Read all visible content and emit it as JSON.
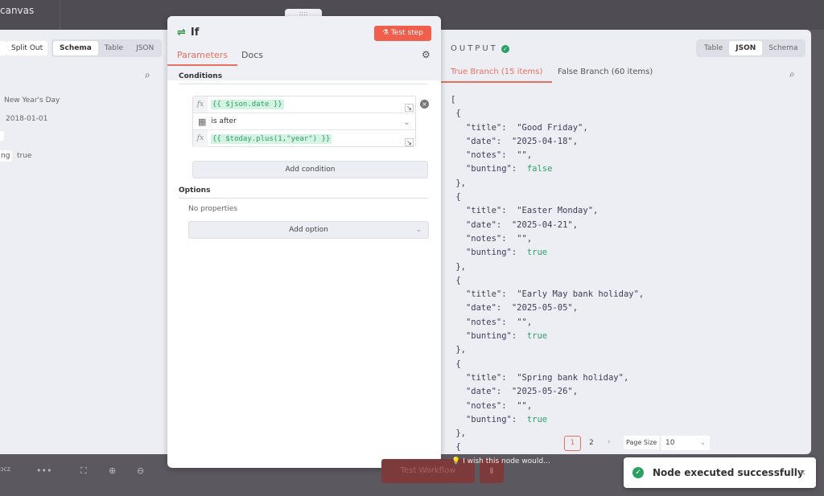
{
  "topbar": {
    "title": "canvas"
  },
  "left_panel": {
    "split_out": "Split Out",
    "views": [
      "Schema",
      "Table",
      "JSON"
    ],
    "active_view": "Schema",
    "rows": [
      {
        "value": "New Year's Day"
      },
      {
        "value": "2018-01-01"
      },
      {
        "key": "ng",
        "value": "true"
      }
    ]
  },
  "node": {
    "title": "If",
    "test_step": "Test step",
    "tabs": [
      "Parameters",
      "Docs"
    ],
    "active_tab": "Parameters",
    "conditions_label": "Conditions",
    "condition": {
      "left": "{{ $json.date }}",
      "operator": "is after",
      "right": "{{ $today.plus(1,\"year\") }}"
    },
    "add_condition": "Add condition",
    "options_label": "Options",
    "no_properties": "No properties",
    "add_option": "Add option"
  },
  "output": {
    "label": "OUTPUT",
    "views": [
      "Table",
      "JSON",
      "Schema"
    ],
    "active_view": "JSON",
    "branches": [
      "True Branch (15 items)",
      "False Branch (60 items)"
    ],
    "active_branch": "True Branch (15 items)",
    "items": [
      {
        "title": "Good Friday",
        "date": "2025-04-18",
        "notes": "",
        "bunting": false
      },
      {
        "title": "Easter Monday",
        "date": "2025-04-21",
        "notes": "",
        "bunting": true
      },
      {
        "title": "Early May bank holiday",
        "date": "2025-05-05",
        "notes": "",
        "bunting": true
      },
      {
        "title": "Spring bank holiday",
        "date": "2025-05-26",
        "notes": "",
        "bunting": true
      }
    ],
    "pagination": {
      "pages": [
        "1",
        "2"
      ],
      "current": "1",
      "next": "›",
      "page_size_label": "Page Size",
      "page_size": "10"
    }
  },
  "footer": {
    "wish": "I wish this node would...",
    "test_workflow": "Test Workflow"
  },
  "toast": {
    "message": "Node executed successfully",
    "close": "×"
  },
  "colors": {
    "accent": "#ef5f4b",
    "success": "#2aa162"
  }
}
